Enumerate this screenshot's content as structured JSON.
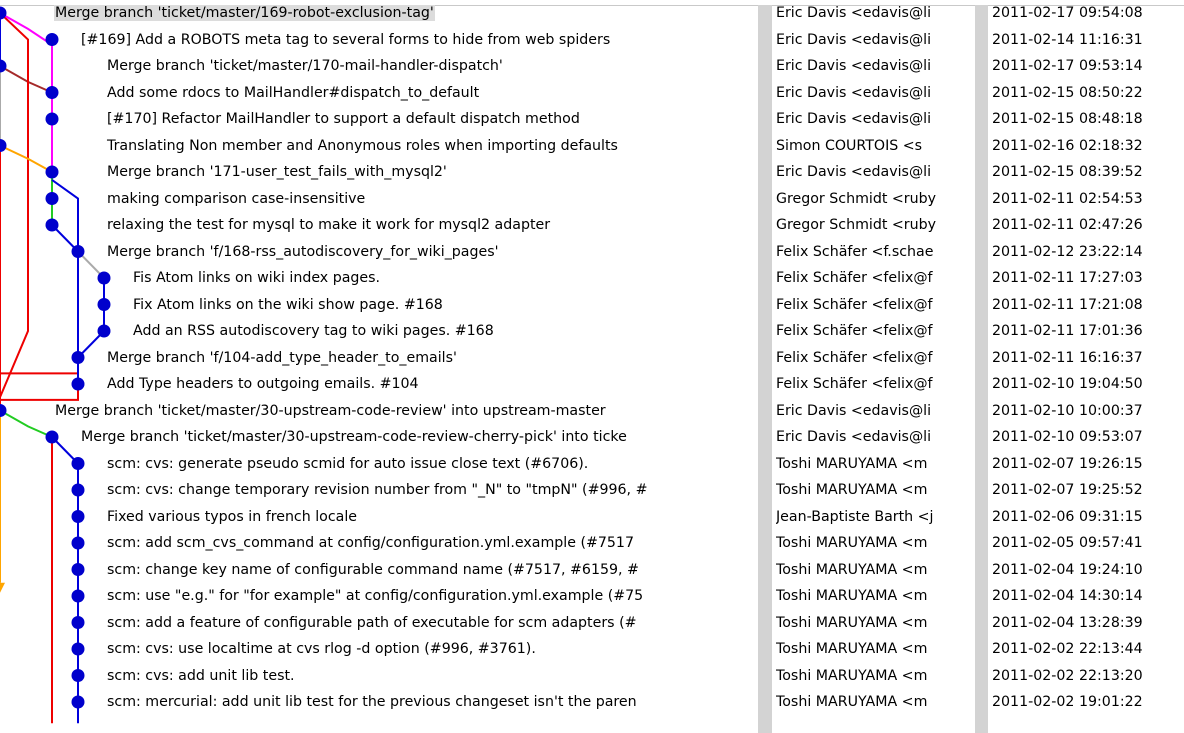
{
  "commits": [
    {
      "subject": "Merge branch 'ticket/master/169-robot-exclusion-tag'",
      "author": "Eric Davis <edavis@li",
      "date": "2011-02-17 09:54:08",
      "selected": true
    },
    {
      "subject": "[#169] Add a ROBOTS meta tag to several forms to hide from web spiders",
      "author": "Eric Davis <edavis@li",
      "date": "2011-02-14 11:16:31"
    },
    {
      "subject": "Merge branch 'ticket/master/170-mail-handler-dispatch'",
      "author": "Eric Davis <edavis@li",
      "date": "2011-02-17 09:53:14"
    },
    {
      "subject": "Add some rdocs to MailHandler#dispatch_to_default",
      "author": "Eric Davis <edavis@li",
      "date": "2011-02-15 08:50:22"
    },
    {
      "subject": "[#170] Refactor MailHandler to support a default dispatch method",
      "author": "Eric Davis <edavis@li",
      "date": "2011-02-15 08:48:18"
    },
    {
      "subject": "Translating Non member and Anonymous roles when importing defaults",
      "author": "Simon COURTOIS <s",
      "date": "2011-02-16 02:18:32"
    },
    {
      "subject": "Merge branch '171-user_test_fails_with_mysql2'",
      "author": "Eric Davis <edavis@li",
      "date": "2011-02-15 08:39:52"
    },
    {
      "subject": "making comparison case-insensitive",
      "author": "Gregor Schmidt <ruby",
      "date": "2011-02-11 02:54:53"
    },
    {
      "subject": "relaxing the test for mysql to make it work for mysql2 adapter",
      "author": "Gregor Schmidt <ruby",
      "date": "2011-02-11 02:47:26"
    },
    {
      "subject": "Merge branch 'f/168-rss_autodiscovery_for_wiki_pages'",
      "author": "Felix Schäfer <f.schae",
      "date": "2011-02-12 23:22:14"
    },
    {
      "subject": "Fis Atom links on wiki index pages.",
      "author": "Felix Schäfer <felix@f",
      "date": "2011-02-11 17:27:03"
    },
    {
      "subject": "Fix Atom links on the wiki show page. #168",
      "author": "Felix Schäfer <felix@f",
      "date": "2011-02-11 17:21:08"
    },
    {
      "subject": "Add an RSS autodiscovery tag to wiki pages. #168",
      "author": "Felix Schäfer <felix@f",
      "date": "2011-02-11 17:01:36"
    },
    {
      "subject": "Merge branch 'f/104-add_type_header_to_emails'",
      "author": "Felix Schäfer <felix@f",
      "date": "2011-02-11 16:16:37"
    },
    {
      "subject": "Add Type headers to outgoing emails. #104",
      "author": "Felix Schäfer <felix@f",
      "date": "2011-02-10 19:04:50"
    },
    {
      "subject": "Merge branch 'ticket/master/30-upstream-code-review' into upstream-master",
      "author": "Eric Davis <edavis@li",
      "date": "2011-02-10 10:00:37"
    },
    {
      "subject": "Merge branch 'ticket/master/30-upstream-code-review-cherry-pick' into ticke",
      "author": "Eric Davis <edavis@li",
      "date": "2011-02-10 09:53:07"
    },
    {
      "subject": "scm: cvs: generate pseudo scmid for auto issue close text (#6706).",
      "author": "Toshi MARUYAMA <m",
      "date": "2011-02-07 19:26:15"
    },
    {
      "subject": "scm: cvs: change temporary revision number from \"_N\" to \"tmpN\" (#996, #",
      "author": "Toshi MARUYAMA <m",
      "date": "2011-02-07 19:25:52"
    },
    {
      "subject": "Fixed various typos in french locale",
      "author": "Jean-Baptiste Barth <j",
      "date": "2011-02-06 09:31:15"
    },
    {
      "subject": "scm: add scm_cvs_command at config/configuration.yml.example (#7517",
      "author": "Toshi MARUYAMA <m",
      "date": "2011-02-05 09:57:41"
    },
    {
      "subject": "scm: change key name of configurable command name (#7517, #6159, #",
      "author": "Toshi MARUYAMA <m",
      "date": "2011-02-04 19:24:10"
    },
    {
      "subject": "scm: use \"e.g.\" for \"for example\" at config/configuration.yml.example (#75",
      "author": "Toshi MARUYAMA <m",
      "date": "2011-02-04 14:30:14"
    },
    {
      "subject": "scm: add a feature of configurable path of executable for scm adapters (#",
      "author": "Toshi MARUYAMA <m",
      "date": "2011-02-04 13:28:39"
    },
    {
      "subject": "scm: cvs: use localtime at cvs rlog -d option (#996, #3761).",
      "author": "Toshi MARUYAMA <m",
      "date": "2011-02-02 22:13:44"
    },
    {
      "subject": "scm: cvs: add unit lib test.",
      "author": "Toshi MARUYAMA <m",
      "date": "2011-02-02 22:13:20"
    },
    {
      "subject": "scm: mercurial: add unit lib test for the previous changeset isn't the paren",
      "author": "Toshi MARUYAMA <m",
      "date": "2011-02-02 19:01:22"
    }
  ],
  "colors": {
    "dot": "#0000cc",
    "red": "#ee0000",
    "blue": "#0000dd",
    "magenta": "#ff00ff",
    "brown": "#a52a2a",
    "grey": "#aaaaaa",
    "orange": "#ffa500",
    "green": "#22cc22",
    "selection": "#dcdcdc"
  }
}
